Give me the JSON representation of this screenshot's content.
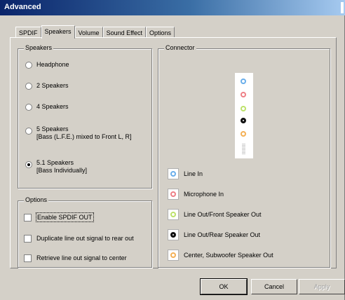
{
  "window": {
    "title": "Advanced"
  },
  "tabs": [
    {
      "label": "SPDIF"
    },
    {
      "label": "Speakers"
    },
    {
      "label": "Volume"
    },
    {
      "label": "Sound Effect"
    },
    {
      "label": "Options"
    }
  ],
  "speakers": {
    "legend": "Speakers",
    "options": [
      {
        "label": "Headphone",
        "selected": false
      },
      {
        "label": "2 Speakers",
        "selected": false
      },
      {
        "label": "4 Speakers",
        "selected": false
      },
      {
        "label": "5 Speakers\n[Bass (L.F.E.) mixed to Front L, R]",
        "selected": false
      },
      {
        "label": "5.1 Speakers\n[Bass Individually]",
        "selected": true
      }
    ]
  },
  "options_group": {
    "legend": "Options",
    "checkboxes": [
      {
        "label": "Enable SPDIF OUT",
        "checked": false
      },
      {
        "label": "Duplicate line out signal to rear out",
        "checked": false
      },
      {
        "label": "Retrieve line out signal to center",
        "checked": false
      }
    ]
  },
  "connector": {
    "legend": "Connector",
    "jacks": [
      {
        "label": "Line In",
        "color": "#6aaeea"
      },
      {
        "label": "Microphone In",
        "color": "#ee7f86"
      },
      {
        "label": "Line Out/Front Speaker Out",
        "color": "#bde26a"
      },
      {
        "label": "Line Out/Rear Speaker Out",
        "color": "#111111"
      },
      {
        "label": "Center, Subwoofer Speaker Out",
        "color": "#f4b055"
      }
    ]
  },
  "buttons": {
    "ok": "OK",
    "cancel": "Cancel",
    "apply": "Apply"
  }
}
